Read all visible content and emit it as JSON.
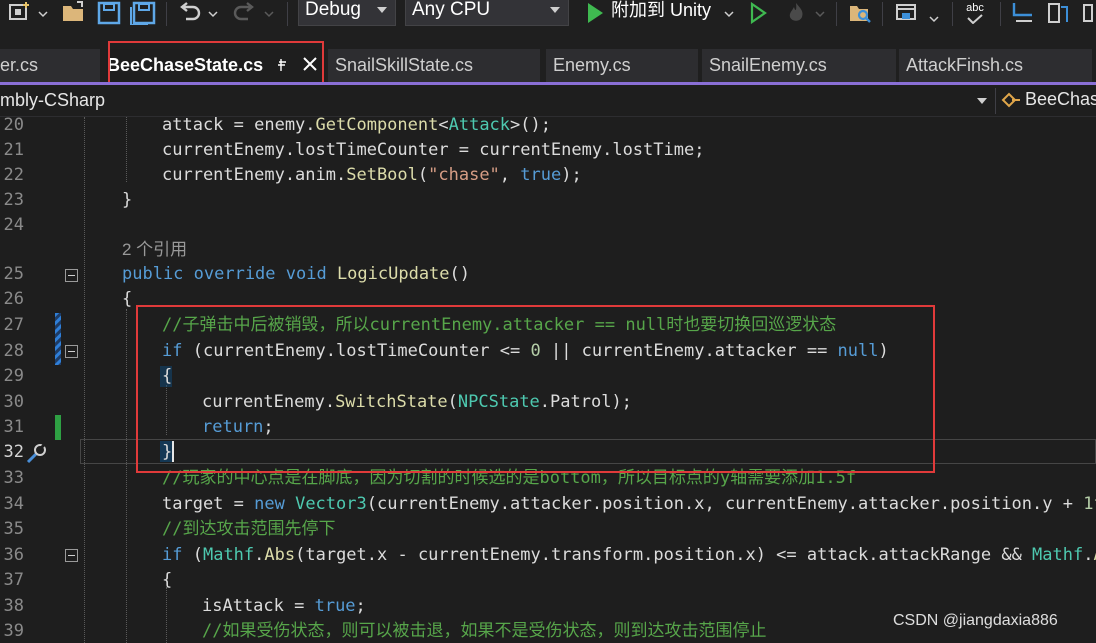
{
  "toolbar": {
    "configuration": "Debug",
    "platform": "Any CPU",
    "attach_label": "附加到 Unity",
    "spell_check_label": "abc",
    "icons": [
      "new-project-icon",
      "open-folder-icon",
      "save-icon",
      "save-all-icon",
      "undo-icon",
      "redo-icon",
      "start-icon",
      "start-without-debugging-icon",
      "hot-reload-icon",
      "find-in-files-icon",
      "browser-link-icon",
      "spell-check-icon",
      "step-icon",
      "solution-explorer-icon"
    ]
  },
  "tabs": [
    {
      "label": "er.cs",
      "active": false
    },
    {
      "label": "BeeChaseState.cs",
      "active": true
    },
    {
      "label": "SnailSkillState.cs",
      "active": false
    },
    {
      "label": "Enemy.cs",
      "active": false
    },
    {
      "label": "SnailEnemy.cs",
      "active": false
    },
    {
      "label": "AttackFinsh.cs",
      "active": false
    }
  ],
  "navbar": {
    "project": "mbly-CSharp",
    "member": "BeeChas"
  },
  "editor": {
    "current_line": 32,
    "line_numbers": [
      "20",
      "21",
      "22",
      "23",
      "24",
      "",
      "25",
      "26",
      "27",
      "28",
      "29",
      "30",
      "31",
      "32",
      "33",
      "34",
      "35",
      "36",
      "37",
      "38",
      "39"
    ],
    "reference_hint": "2 个引用",
    "comment_1": "//子弹击中后被销毁，所以currentEnemy.attacker == null时也要切换回巡逻状态",
    "comment_2": "//玩家的中心点是在脚底，因为切割的时候选的是bottom，所以目标点的y轴需要添加1.5f",
    "comment_3": "//到达攻击范围先停下",
    "comment_4": "//如果受伤状态，则可以被击退，如果不是受伤状态，则到达攻击范围停止"
  },
  "watermark": "CSDN @jiangdaxia886",
  "colors": {
    "keyword": "#569cd6",
    "type": "#4ec9b0",
    "method": "#dcdcaa",
    "string": "#d69d85",
    "comment": "#57a64a",
    "number": "#b5cea8",
    "highlight_box": "#e03a3a",
    "tab_accent": "#8a6fd6"
  }
}
